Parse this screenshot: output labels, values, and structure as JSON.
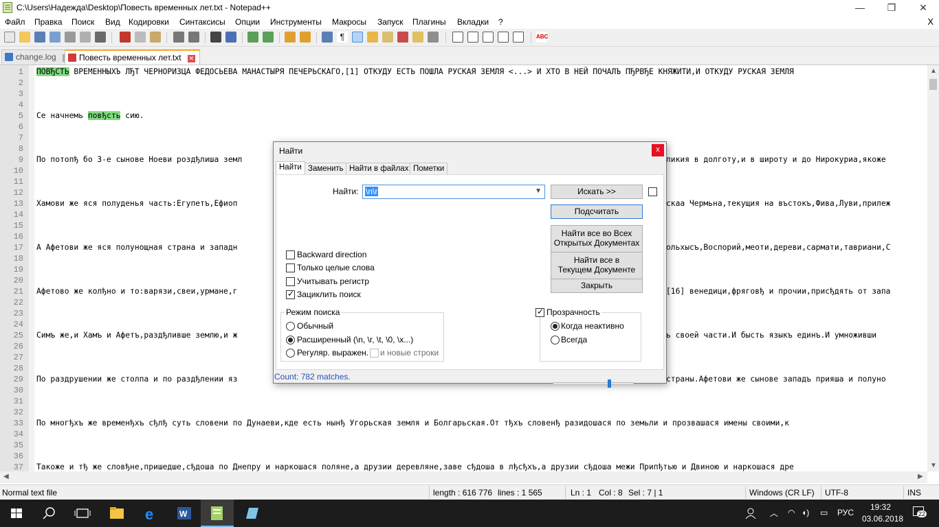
{
  "window": {
    "title": "C:\\Users\\Надежда\\Desktop\\Повесть временных лет.txt - Notepad++",
    "minimize": "—",
    "restore": "❐",
    "close": "✕"
  },
  "menu": [
    "Файл",
    "Правка",
    "Поиск",
    "Вид",
    "Кодировки",
    "Синтаксисы",
    "Опции",
    "Инструменты",
    "Макросы",
    "Запуск",
    "Плагины",
    "Вкладки",
    "?"
  ],
  "menu_close": "X",
  "tabs": [
    {
      "label": "change.log",
      "active": false
    },
    {
      "label": "Повесть временных лет.txt",
      "active": true
    }
  ],
  "editor": {
    "line_numbers": [
      "1",
      "2",
      "3",
      "4",
      "5",
      "6",
      "7",
      "8",
      "9",
      "10",
      "11",
      "12",
      "13",
      "14",
      "15",
      "16",
      "17",
      "18",
      "19",
      "20",
      "21",
      "22",
      "23",
      "24",
      "25",
      "26",
      "27",
      "28",
      "29",
      "30",
      "31",
      "32",
      "33",
      "34",
      "35",
      "36",
      "37"
    ],
    "line1_hl": "ПОВЂСТЬ",
    "line1_rest": " ВРЕМЕННЫХЪ ЛЂТ ЧЕРНОРИЗЦА ФЕДОСЬЕВА МАНАСТЫРЯ ПЕЧЕРЬСКАГО,[1] ОТКУДУ ЕСТЬ ПОШЛА РУСКАЯ ЗЕМЛЯ <...> И ХТО В НЕЙ ПОЧАЛЪ ПЂРВЂЕ КНЯЖИТИ,И ОТКУДУ РУСКАЯ ЗЕМЛЯ",
    "line5_a": "Се начнемь ",
    "line5_hl": "повђсть",
    "line5_b": " сию.",
    "line9_a": "По потопђ бо 3-е сынове Ноеви роздђлиша земл",
    "line9_b": "ликия в долготу,и в широту и до Нирокуриа,якоже",
    "line13_a": "Хамови же яся полуденья часть:Егупетъ,Ефиоп",
    "line13_b": "скаа Чермьна,текущия на въстокъ,Фива,Луви,прилеж",
    "line17_a": "А Афетови же яся полунощная страна и западн",
    "line17_b": "ольхысъ,Воспорий,меоти,дереви,сармати,тавриани,С",
    "line21_a": "Афетово же колђно и то:варязи,свеи,урмане,г",
    "line21_b": "[16] венедици,фряговђ и прочии,присђдять от запа",
    "line25_a": "Симъ же,и Хамъ и Афетъ,раздђливше землю,и ж",
    "line25_b": "ь своей части.И бысть языкъ единъ.И умноживши",
    "line29_a": "По раздрушении же столпа и по раздђлении яз",
    "line29_b": "страны.Афетови же сынове западъ прияша и полуно",
    "line33": "По многђхъ же временђхъ сђлђ суть словени по Дунаеви,кде есть нынђ Угорьская земля и Болгарьская.От тђхъ словенђ разидошася по земьли и прозвашася имены своими,к",
    "line37": "Такоже и тђ же словђне,пришедше,сђдоша по Днепру и наркошася поляне,а друзии деревляне,заве сђдоша в лђсђхъ,а друзии сђдоша межи Припђтью и Двиною и наркошася дре"
  },
  "status": {
    "type": "Normal text file",
    "length": "length : 616 776",
    "lines": "lines : 1 565",
    "ln": "Ln : 1",
    "col": "Col : 8",
    "sel": "Sel : 7 | 1",
    "eol": "Windows (CR LF)",
    "encoding": "UTF-8",
    "ins": "INS"
  },
  "dialog": {
    "title": "Найти",
    "close": "x",
    "tabs": [
      "Найти",
      "Заменить",
      "Найти в файлах",
      "Пометки"
    ],
    "find_label": "Найти:",
    "find_value": "\\n\\r",
    "buttons": {
      "find_next": "Искать >>",
      "count": "Подсчитать",
      "find_all_open_1": "Найти все во Всех",
      "find_all_open_2": "Открытых Документах",
      "find_all_current_1": "Найти все в",
      "find_all_current_2": "Текущем Документе",
      "close": "Закрыть"
    },
    "options": {
      "backward": "Backward direction",
      "whole_word": "Только целые слова",
      "match_case": "Учитывать регистр",
      "wrap": "Зациклить поиск"
    },
    "search_mode": {
      "title": "Режим поиска",
      "normal": "Обычный",
      "extended": "Расширенный (\\n, \\r, \\t, \\0, \\x...)",
      "regex": "Регуляр. выражен.",
      "dot_newline": "и новые строки"
    },
    "transparency": {
      "title": "Прозрачность",
      "on_lose_focus": "Когда неактивно",
      "always": "Всегда",
      "level": 0.7
    },
    "status": "Count: 782 matches."
  },
  "taskbar": {
    "lang": "РУС",
    "time": "19:32",
    "date": "03.06.2018",
    "notif": "22"
  }
}
